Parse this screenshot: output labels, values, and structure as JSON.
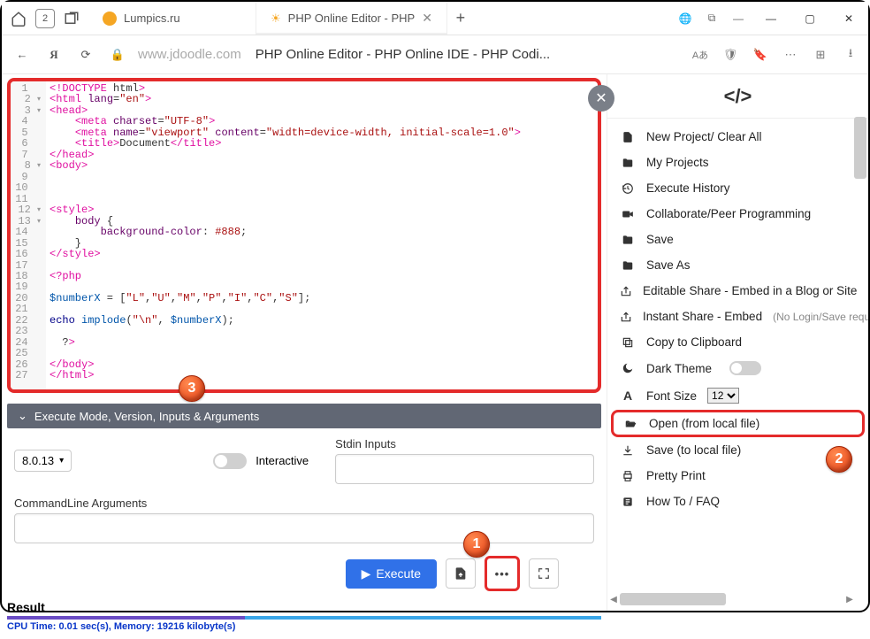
{
  "titlebar": {
    "counter": "2",
    "tabs": [
      {
        "label": "Lumpics.ru",
        "favColor": "#f5a623"
      },
      {
        "label": "PHP Online Editor - PHP",
        "favEmoji": "☀"
      }
    ],
    "addTab": "+"
  },
  "urlbar": {
    "domain": "www.jdoodle.com",
    "title": "PHP Online Editor - PHP Online IDE - PHP Codi...",
    "langBadge": "Aあ",
    "ext1": "1"
  },
  "editor": {
    "lines": [
      {
        "n": "1",
        "code": "<!DOCTYPE html>",
        "fold": false
      },
      {
        "n": "2",
        "code": "<html lang=\"en\">",
        "fold": true
      },
      {
        "n": "3",
        "code": "<head>",
        "fold": true
      },
      {
        "n": "4",
        "code": "    <meta charset=\"UTF-8\">",
        "fold": false
      },
      {
        "n": "5",
        "code": "    <meta name=\"viewport\" content=\"width=device-width, initial-scale=1.0\">",
        "fold": false
      },
      {
        "n": "6",
        "code": "    <title>Document</title>",
        "fold": false
      },
      {
        "n": "7",
        "code": "</head>",
        "fold": false
      },
      {
        "n": "8",
        "code": "<body>",
        "fold": true
      },
      {
        "n": "9",
        "code": "",
        "fold": false
      },
      {
        "n": "10",
        "code": "",
        "fold": false
      },
      {
        "n": "11",
        "code": "",
        "fold": false
      },
      {
        "n": "12",
        "code": "<style>",
        "fold": true
      },
      {
        "n": "13",
        "code": "    body {",
        "fold": true
      },
      {
        "n": "14",
        "code": "        background-color: #888;",
        "fold": false
      },
      {
        "n": "15",
        "code": "    }",
        "fold": false
      },
      {
        "n": "16",
        "code": "</style>",
        "fold": false
      },
      {
        "n": "17",
        "code": "",
        "fold": false
      },
      {
        "n": "18",
        "code": "<?php",
        "fold": false
      },
      {
        "n": "19",
        "code": "",
        "fold": false
      },
      {
        "n": "20",
        "code": "$numberX = [\"L\",\"U\",\"M\",\"P\",\"I\",\"C\",\"S\"];",
        "fold": false
      },
      {
        "n": "21",
        "code": "",
        "fold": false
      },
      {
        "n": "22",
        "code": "echo implode(\"\\n\", $numberX);",
        "fold": false
      },
      {
        "n": "23",
        "code": "",
        "fold": false
      },
      {
        "n": "24",
        "code": "  ?>",
        "fold": false
      },
      {
        "n": "25",
        "code": "",
        "fold": false
      },
      {
        "n": "26",
        "code": "</body>",
        "fold": false
      },
      {
        "n": "27",
        "code": "</html>",
        "fold": false
      }
    ]
  },
  "exec": {
    "header": "Execute Mode, Version, Inputs & Arguments",
    "version": "8.0.13",
    "interactiveLabel": "Interactive",
    "stdinLabel": "Stdin Inputs",
    "cmdLabel": "CommandLine Arguments",
    "executeBtn": "Execute"
  },
  "result": {
    "title": "Result",
    "stats": "CPU Time: 0.01 sec(s), Memory: 19216 kilobyte(s)"
  },
  "side": {
    "items": [
      {
        "icon": "file",
        "label": "New Project/ Clear All"
      },
      {
        "icon": "folder",
        "label": "My Projects"
      },
      {
        "icon": "history",
        "label": "Execute History"
      },
      {
        "icon": "video",
        "label": "Collaborate/Peer Programming"
      },
      {
        "icon": "folder",
        "label": "Save"
      },
      {
        "icon": "folder",
        "label": "Save As"
      },
      {
        "icon": "share",
        "label": "Editable Share - Embed in a Blog or Site"
      },
      {
        "icon": "share",
        "label": "Instant Share - Embed",
        "muted": "(No Login/Save requ"
      },
      {
        "icon": "copy",
        "label": "Copy to Clipboard"
      },
      {
        "icon": "moon",
        "label": "Dark Theme",
        "toggle": true
      },
      {
        "icon": "font",
        "label": "Font Size",
        "select": "12"
      },
      {
        "icon": "open",
        "label": "Open (from local file)",
        "hl": true
      },
      {
        "icon": "download",
        "label": "Save (to local file)"
      },
      {
        "icon": "print",
        "label": "Pretty Print"
      },
      {
        "icon": "help",
        "label": "How To / FAQ"
      }
    ]
  },
  "badges": {
    "1": "1",
    "2": "2",
    "3": "3"
  }
}
